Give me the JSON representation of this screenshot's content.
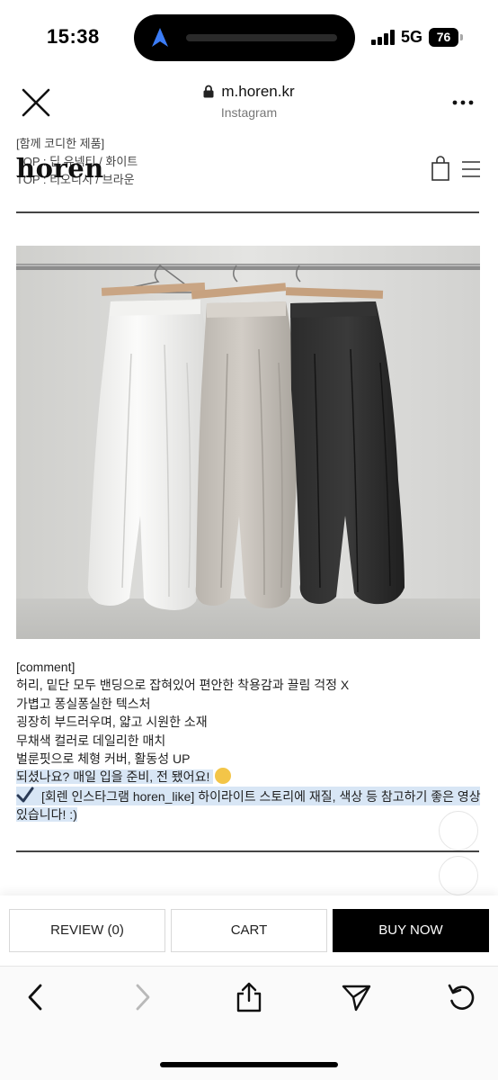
{
  "status_bar": {
    "time": "15:38",
    "network": "5G",
    "battery": "76"
  },
  "browser": {
    "url": "m.horen.kr",
    "source_label": "Instagram"
  },
  "site": {
    "logo": "horen",
    "related_heading": "[함께 코디한 제품]",
    "related_items": [
      "TOP : 딥 유넥티 / 화이트",
      "TOP : 티오니시 / 브라운"
    ]
  },
  "comment": {
    "title": "[comment]",
    "lines": [
      "허리, 밑단 모두 밴딩으로 잡혀있어 편안한 착용감과 끌림 걱정 X",
      "가볍고 퐁실퐁실한 텍스처",
      "굉장히 부드러우며, 얇고 시원한 소재",
      "무채색 컬러로 데일리한 매치",
      "벌룬핏으로 체형 커버, 활동성 UP"
    ],
    "highlight_line": "되셨나요? 매일 입을 준비, 전 됐어요!",
    "note_line_1": "[회렌 인스타그램 horen_like] 하이라이트 스토리에 재질, 색상 등 참고하기 좋은 영상",
    "note_line_2": "있습니다! :)"
  },
  "buttons": {
    "review": "REVIEW (0)",
    "cart": "CART",
    "buy_now": "BUY NOW"
  },
  "colors": {
    "highlight": "#d8e6f5",
    "buy_button": "#000000",
    "accent_arrow": "#3b7cf6"
  },
  "icons": {
    "close": "close-icon",
    "lock": "lock-icon",
    "more": "more-icon",
    "bag": "shopping-bag-icon",
    "menu": "hamburger-menu-icon",
    "back": "chevron-left-icon",
    "forward": "chevron-right-icon",
    "share": "share-icon",
    "send": "send-icon",
    "reload": "reload-icon"
  }
}
